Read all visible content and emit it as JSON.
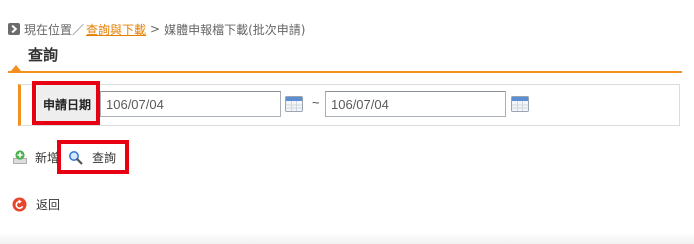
{
  "breadcrumb": {
    "icon": "arrow-right-icon",
    "location_label": "現在位置／",
    "parent_link": "查詢與下載",
    "separator": ">",
    "current_page": "媒體申報檔下載(批次申請)"
  },
  "section": {
    "title": "查詢"
  },
  "query_form": {
    "date_label": "申請日期",
    "date_from_value": "106/07/04",
    "range_separator": "~",
    "date_to_value": "106/07/04",
    "calendar_icon": "calendar-icon"
  },
  "actions": {
    "add": {
      "label": "新增",
      "icon": "add-icon"
    },
    "search": {
      "label": "查詢",
      "icon": "magnifier-icon"
    },
    "back": {
      "label": "返回",
      "icon": "back-arrow-icon"
    }
  },
  "colors": {
    "accent_orange": "#f39020",
    "link_orange": "#e67e00",
    "highlight_red": "#e60012",
    "label_bg": "#eeeeee",
    "text_gray": "#555555"
  }
}
